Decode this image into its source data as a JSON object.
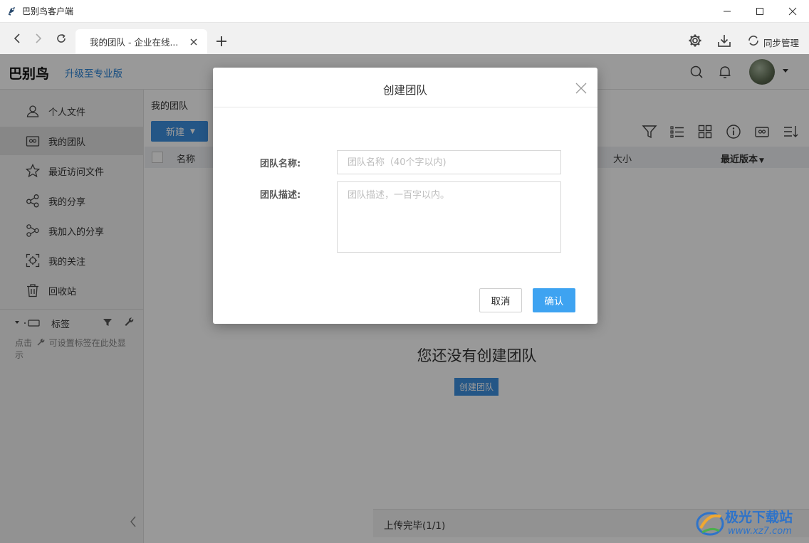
{
  "window": {
    "title": "巴别鸟客户端"
  },
  "tabbar": {
    "tab_label": "我的团队 - 企业在线...",
    "sync_label": "同步管理"
  },
  "header": {
    "brand": "巴别鸟",
    "upgrade": "升级至专业版"
  },
  "sidebar": {
    "items": [
      {
        "label": "个人文件",
        "icon": "person-icon"
      },
      {
        "label": "我的团队",
        "icon": "team-icon"
      },
      {
        "label": "最近访问文件",
        "icon": "star-icon"
      },
      {
        "label": "我的分享",
        "icon": "share-icon"
      },
      {
        "label": "我加入的分享",
        "icon": "joined-share-icon"
      },
      {
        "label": "我的关注",
        "icon": "focus-icon"
      },
      {
        "label": "回收站",
        "icon": "trash-icon"
      }
    ],
    "tags_label": "标签",
    "tags_hint_prefix": "点击",
    "tags_hint_suffix": "可设置标签在此处显示"
  },
  "main": {
    "breadcrumb": "我的团队",
    "new_button": "新建",
    "columns": {
      "name": "名称",
      "size": "大小",
      "version": "最近版本"
    },
    "empty_title": "您还没有创建团队",
    "empty_button": "创建团队"
  },
  "upload": {
    "status": "上传完毕(1/1)"
  },
  "dialog": {
    "title": "创建团队",
    "name_label": "团队名称:",
    "name_placeholder": "团队名称（40个字以内)",
    "name_value": "",
    "desc_label": "团队描述:",
    "desc_placeholder": "团队描述，一百字以内。",
    "desc_value": "",
    "cancel": "取消",
    "confirm": "确认"
  },
  "watermark": {
    "text": "极光下载站",
    "url": "www.xz7.com"
  },
  "colors": {
    "accent": "#3d8fe0",
    "confirm": "#3ea3f1",
    "link": "#2b84d8"
  }
}
